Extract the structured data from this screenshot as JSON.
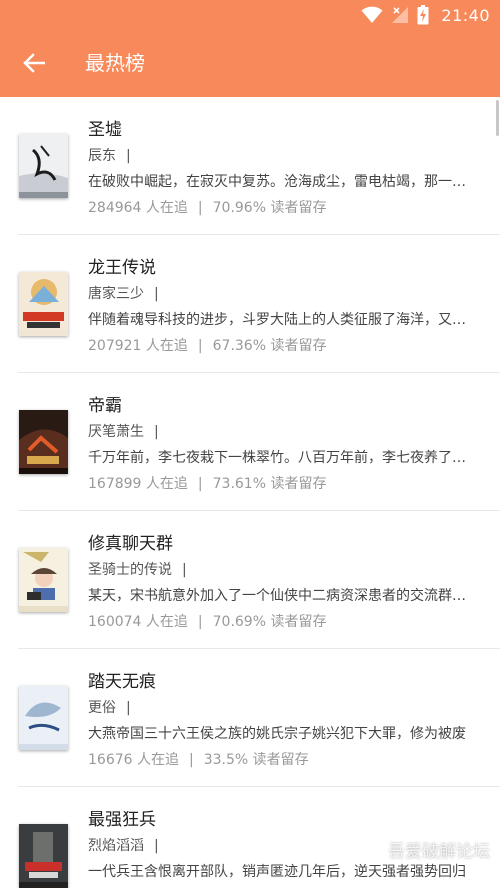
{
  "status_bar": {
    "time": "21:40"
  },
  "header": {
    "title": "最热榜"
  },
  "watermark": "吾爱破解论坛",
  "colors": {
    "accent": "#f8895b"
  },
  "books": [
    {
      "title": "圣墟",
      "author": "辰东",
      "description": "在破败中崛起，在寂灭中复苏。沧海成尘，雷电枯竭，那一缕幽雾又一次临近大地，世间的枷锁被打开了",
      "followers": "284964",
      "followers_suffix": "人在追",
      "retention": "70.96%",
      "retention_suffix": "读者留存"
    },
    {
      "title": "龙王传说",
      "author": "唐家三少",
      "description": "伴随着魂导科技的进步，斗罗大陆上的人类征服了海洋，又发现了两块大陆",
      "followers": "207921",
      "followers_suffix": "人在追",
      "retention": "67.36%",
      "retention_suffix": "读者留存"
    },
    {
      "title": "帝霸",
      "author": "厌笔萧生",
      "description": "千万年前，李七夜栽下一株翠竹。八百万年前，李七夜养了一条鲤鱼",
      "followers": "167899",
      "followers_suffix": "人在追",
      "retention": "73.61%",
      "retention_suffix": "读者留存"
    },
    {
      "title": "修真聊天群",
      "author": "圣骑士的传说",
      "description": "某天，宋书航意外加入了一个仙侠中二病资深患者的交流群，里面的群友们都以‘道友’相称",
      "followers": "160074",
      "followers_suffix": "人在追",
      "retention": "70.69%",
      "retention_suffix": "读者留存"
    },
    {
      "title": "踏天无痕",
      "author": "更俗",
      "description": "大燕帝国三十六王侯之族的姚氏宗子姚兴犯下大罪，修为被废",
      "followers": "16676",
      "followers_suffix": "人在追",
      "retention": "33.5%",
      "retention_suffix": "读者留存"
    },
    {
      "title": "最强狂兵",
      "author": "烈焰滔滔",
      "description": "一代兵王含恨离开部队，销声匿迹几年后，逆天强者强势回归",
      "followers": "",
      "followers_suffix": "",
      "retention": "",
      "retention_suffix": ""
    }
  ]
}
